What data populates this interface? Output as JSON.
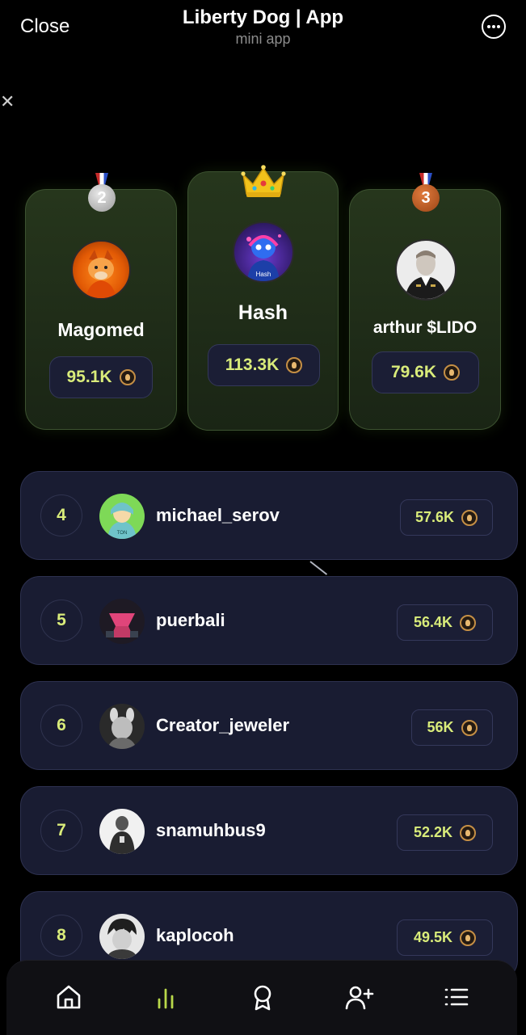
{
  "header": {
    "close_label": "Close",
    "title": "Liberty Dog | App",
    "subtitle": "mini app",
    "more_icon": "more-icon"
  },
  "podium": {
    "first": {
      "name": "Hash",
      "score": "113.3K",
      "badge": "crown-icon"
    },
    "second": {
      "name": "Magomed",
      "score": "95.1K",
      "badge": "2"
    },
    "third": {
      "name": "arthur $LIDO",
      "score": "79.6K",
      "badge": "3"
    }
  },
  "leaderboard": [
    {
      "rank": "4",
      "name": "michael_serov",
      "score": "57.6K"
    },
    {
      "rank": "5",
      "name": "puerbali",
      "score": "56.4K"
    },
    {
      "rank": "6",
      "name": "Creator_jeweler",
      "score": "56K"
    },
    {
      "rank": "7",
      "name": "snamuhbus9",
      "score": "52.2K"
    },
    {
      "rank": "8",
      "name": "kaplocoh",
      "score": "49.5K"
    }
  ],
  "nav": {
    "items": [
      "home-icon",
      "leaderboard-icon",
      "rewards-icon",
      "invite-friend-icon",
      "menu-icon"
    ],
    "active": "leaderboard-icon"
  },
  "colors": {
    "accent": "#d9ec7a",
    "nav_active": "#b9d84a",
    "podium_bg": "#26361c",
    "row_bg": "#191c32"
  }
}
